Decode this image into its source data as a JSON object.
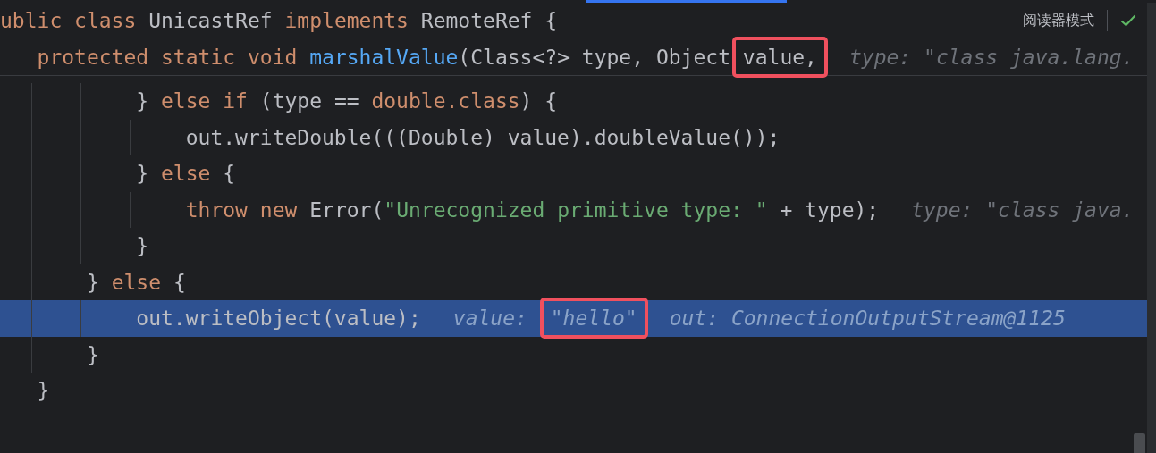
{
  "editor": {
    "reader_mode_label": "阅读器模式",
    "header_lines": [
      {
        "current": false,
        "tokens": [
          {
            "kind": "keyword",
            "text": "ublic class ",
            "boxed": false
          },
          {
            "kind": "plain",
            "text": "UnicastRef ",
            "boxed": false
          },
          {
            "kind": "keyword",
            "text": "implements ",
            "boxed": false
          },
          {
            "kind": "plain",
            "text": "RemoteRef {",
            "boxed": false
          }
        ]
      },
      {
        "current": false,
        "tokens": [
          {
            "kind": "keyword",
            "text": "   protected static void ",
            "boxed": false
          },
          {
            "kind": "method",
            "text": "marshalValue",
            "boxed": false
          },
          {
            "kind": "plain",
            "text": "(Class<?> type, Object ",
            "boxed": false
          },
          {
            "kind": "plain",
            "text": "value,",
            "boxed": true
          },
          {
            "kind": "hint",
            "text": "type: \"class java.lang.",
            "boxed": false
          }
        ]
      }
    ],
    "lines": [
      {
        "current": false,
        "tokens": [
          {
            "kind": "plain",
            "text": "           } ",
            "boxed": false
          },
          {
            "kind": "keyword",
            "text": "else if ",
            "boxed": false
          },
          {
            "kind": "plain",
            "text": "(type == ",
            "boxed": false
          },
          {
            "kind": "keyword",
            "text": "double.class",
            "boxed": false
          },
          {
            "kind": "plain",
            "text": ") {",
            "boxed": false
          }
        ]
      },
      {
        "current": false,
        "tokens": [
          {
            "kind": "plain",
            "text": "               out.writeDouble(((Double) value).doubleValue());",
            "boxed": false
          }
        ]
      },
      {
        "current": false,
        "tokens": [
          {
            "kind": "plain",
            "text": "           } ",
            "boxed": false
          },
          {
            "kind": "keyword",
            "text": "else ",
            "boxed": false
          },
          {
            "kind": "plain",
            "text": "{",
            "boxed": false
          }
        ]
      },
      {
        "current": false,
        "tokens": [
          {
            "kind": "keyword",
            "text": "               throw new ",
            "boxed": false
          },
          {
            "kind": "plain",
            "text": "Error(",
            "boxed": false
          },
          {
            "kind": "string",
            "text": "\"Unrecognized primitive type: \"",
            "boxed": false
          },
          {
            "kind": "plain",
            "text": " + type);",
            "boxed": false
          },
          {
            "kind": "hint",
            "text": "type: \"class java.",
            "boxed": false
          }
        ]
      },
      {
        "current": false,
        "tokens": [
          {
            "kind": "plain",
            "text": "           }",
            "boxed": false
          }
        ]
      },
      {
        "current": false,
        "tokens": [
          {
            "kind": "plain",
            "text": "       } ",
            "boxed": false
          },
          {
            "kind": "keyword",
            "text": "else ",
            "boxed": false
          },
          {
            "kind": "plain",
            "text": "{",
            "boxed": false
          }
        ]
      },
      {
        "current": true,
        "tokens": [
          {
            "kind": "plain",
            "text": "           out.writeObject(value);",
            "boxed": false
          },
          {
            "kind": "hint",
            "text": "value: ",
            "boxed": false
          },
          {
            "kind": "hint-value",
            "text": "\"hello\"",
            "boxed": true
          },
          {
            "kind": "hint",
            "text": "out: ConnectionOutputStream@1125",
            "boxed": false
          }
        ]
      },
      {
        "current": false,
        "tokens": [
          {
            "kind": "plain",
            "text": "       }",
            "boxed": false
          }
        ]
      },
      {
        "current": false,
        "tokens": [
          {
            "kind": "plain",
            "text": "   }",
            "boxed": false
          }
        ]
      },
      {
        "current": false
      }
    ]
  }
}
